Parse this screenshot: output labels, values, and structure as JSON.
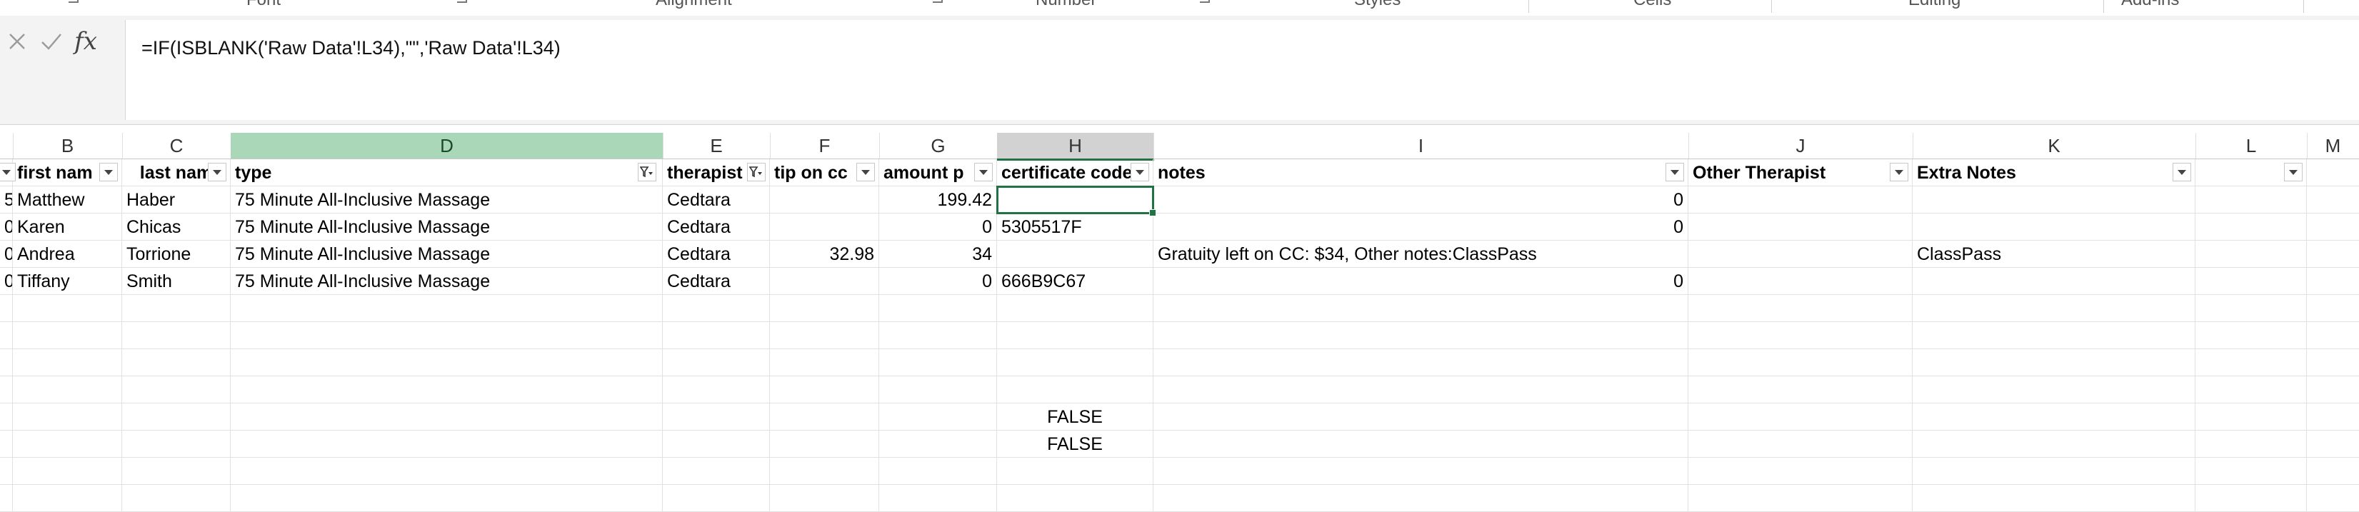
{
  "ribbon": {
    "groups": [
      "Font",
      "Alignment",
      "Number",
      "Styles",
      "Cells",
      "Editing",
      "Add-ins"
    ]
  },
  "formula_bar": {
    "cancel_icon": "close-icon",
    "enter_icon": "check-icon",
    "fx_label": "fx",
    "formula": "=IF(ISBLANK('Raw Data'!L34),\"\",'Raw Data'!L34)"
  },
  "columns": [
    "B",
    "C",
    "D",
    "E",
    "F",
    "G",
    "H",
    "I",
    "J",
    "K",
    "L",
    "M"
  ],
  "table": {
    "headers": [
      "first nam",
      "last nam",
      "type",
      "therapist",
      "tip on cc",
      "amount p",
      "certificate code",
      "notes",
      "Other Therapist",
      "Extra Notes",
      ""
    ],
    "rows": [
      {
        "a": "5",
        "b": "Matthew",
        "c": "Haber",
        "d": "75 Minute All-Inclusive Massage",
        "e": "Cedtara",
        "f": "",
        "g": "199.42",
        "h": "",
        "i": "0",
        "j": "",
        "k": ""
      },
      {
        "a": "0",
        "b": "Karen",
        "c": "Chicas",
        "d": "75 Minute All-Inclusive Massage",
        "e": "Cedtara",
        "f": "",
        "g": "0",
        "h": "5305517F",
        "i": "0",
        "j": "",
        "k": ""
      },
      {
        "a": "0",
        "b": "Andrea",
        "c": "Torrione",
        "d": "75 Minute All-Inclusive Massage",
        "e": "Cedtara",
        "f": "32.98",
        "g": "34",
        "h": "",
        "i": "Gratuity left on CC: $34, Other notes:ClassPass",
        "j": "",
        "k": "ClassPass"
      },
      {
        "a": "0",
        "b": "Tiffany",
        "c": "Smith",
        "d": "75 Minute All-Inclusive Massage",
        "e": "Cedtara",
        "f": "",
        "g": "0",
        "h": "666B9C67",
        "i": "0",
        "j": "",
        "k": ""
      }
    ],
    "extra_values": [
      "FALSE",
      "FALSE"
    ]
  },
  "colors": {
    "selected_column": "#a9d7b8",
    "active_border": "#217346"
  }
}
